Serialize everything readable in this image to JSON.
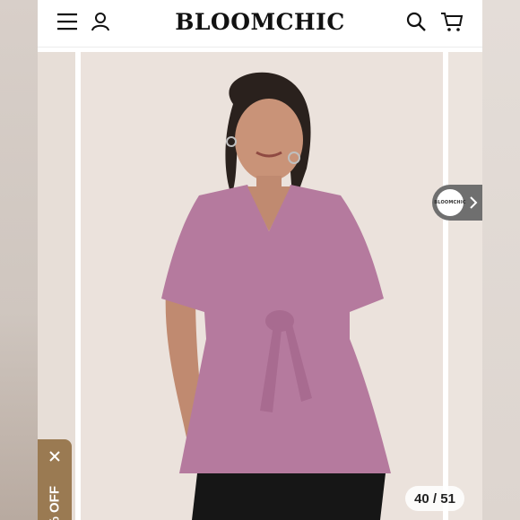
{
  "header": {
    "logo_text": "BLOOMCHIC",
    "icons": [
      "menu-icon",
      "account-icon",
      "search-icon",
      "cart-icon"
    ]
  },
  "gallery": {
    "counter": "40 / 51",
    "next_thumb_brand": "BLOOMCHIC",
    "product_color": "#b57a9e"
  },
  "promo": {
    "text": "% OFF"
  },
  "colors": {
    "background": "#ebe2dc",
    "header_bg": "#ffffff",
    "promo_bg": "#9a7a52",
    "text": "#111111"
  }
}
